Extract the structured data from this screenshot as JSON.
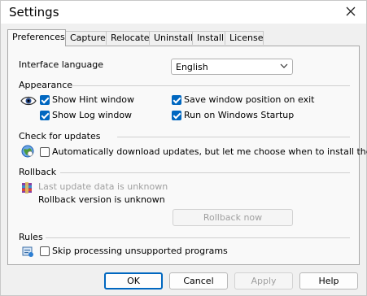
{
  "window": {
    "title": "Settings"
  },
  "tabs": [
    {
      "label": "Preferences",
      "active": true
    },
    {
      "label": "Capture",
      "active": false
    },
    {
      "label": "Relocate",
      "active": false
    },
    {
      "label": "Uninstall",
      "active": false
    },
    {
      "label": "Install",
      "active": false
    },
    {
      "label": "License",
      "active": false
    }
  ],
  "preferences": {
    "language": {
      "label": "Interface language",
      "value": "English"
    },
    "appearance": {
      "title": "Appearance",
      "show_hint": {
        "label": "Show Hint window",
        "checked": true
      },
      "show_log": {
        "label": "Show Log window",
        "checked": true
      },
      "save_position": {
        "label": "Save window position on exit",
        "checked": true
      },
      "run_startup": {
        "label": "Run on Windows Startup",
        "checked": true
      }
    },
    "updates": {
      "title": "Check for updates",
      "auto_download": {
        "label": "Automatically download updates, but let me choose when to install them",
        "checked": false
      }
    },
    "rollback": {
      "title": "Rollback",
      "last_update": "Last update data is unknown",
      "version": "Rollback version is unknown",
      "button": "Rollback now"
    },
    "rules": {
      "title": "Rules",
      "skip_unsupported": {
        "label": "Skip processing unsupported programs",
        "checked": false
      }
    }
  },
  "footer": {
    "ok": "OK",
    "cancel": "Cancel",
    "apply": "Apply",
    "help": "Help"
  },
  "colors": {
    "accent": "#0067c0",
    "disabled": "#a0a0a0"
  },
  "icons": [
    "close-icon",
    "eye-icon",
    "globe-icon",
    "archive-icon",
    "rules-icon",
    "dropdown-arrow-icon"
  ]
}
